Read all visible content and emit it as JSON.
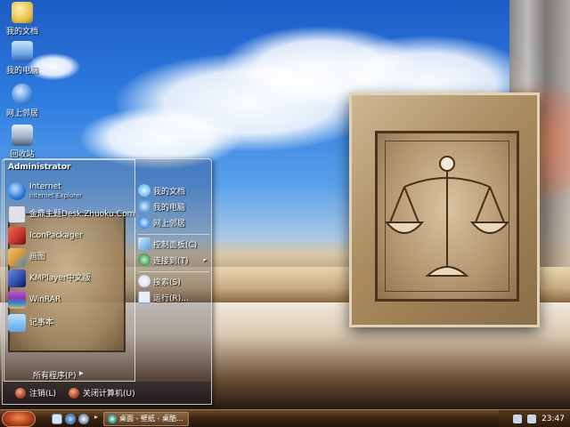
{
  "desktop": {
    "icons": [
      {
        "label": "我的文档",
        "icon": "my-documents-icon",
        "color": "#e8c24a"
      },
      {
        "label": "我的电脑",
        "icon": "my-computer-icon",
        "color": "#6fa8e8"
      },
      {
        "label": "网上邻居",
        "icon": "network-icon",
        "color": "#4a8ad8"
      },
      {
        "label": "回收站",
        "icon": "recycle-bin-icon",
        "color": "#9ab0c8"
      }
    ]
  },
  "start_menu": {
    "user": "Administrator",
    "left_items": [
      {
        "label": "Internet",
        "sub": "Internet Explorer",
        "icon": "internet-explorer-icon",
        "color": "#2a7ad8"
      },
      {
        "label": "金鼎主题Desk.Zhuoku.Com",
        "sub": "",
        "icon": "theme-app-icon",
        "color": "#e0e0e8"
      },
      {
        "label": "IconPackager",
        "sub": "",
        "icon": "iconpackager-icon",
        "color": "#c8302a"
      },
      {
        "label": "画图",
        "sub": "",
        "icon": "paint-icon",
        "color": "#d89a3a"
      },
      {
        "label": "KMPlayer中文版",
        "sub": "",
        "icon": "kmplayer-icon",
        "color": "#2a4aa8"
      },
      {
        "label": "WinRAR",
        "sub": "",
        "icon": "winrar-icon",
        "color": "#8a3aa8"
      },
      {
        "label": "记事本",
        "sub": "",
        "icon": "notepad-icon",
        "color": "#5aa8e8"
      }
    ],
    "all_programs": "所有程序(P)",
    "right_items": [
      {
        "label": "我的文档",
        "icon": "my-documents-icon",
        "color": "#6fc0e8"
      },
      {
        "label": "我的电脑",
        "icon": "my-computer-icon",
        "color": "#5a9ad8"
      },
      {
        "label": "网上邻居",
        "icon": "network-icon",
        "color": "#3a8ae8"
      },
      {
        "label": "控制面板(C)",
        "icon": "control-panel-icon",
        "color": "#4aa0d8"
      },
      {
        "label": "连接到(T)",
        "icon": "connect-icon",
        "color": "#3a9a5a"
      },
      {
        "label": "搜索(S)",
        "icon": "search-icon",
        "color": "#d8e4f4"
      },
      {
        "label": "运行(R)...",
        "icon": "run-icon",
        "color": "#e8eef8"
      }
    ],
    "logoff": "注销(L)",
    "shutdown": "关闭计算机(U)"
  },
  "taskbar": {
    "task_label": "桌面 - 壁纸 - 桌酷...",
    "clock": "23:47"
  }
}
